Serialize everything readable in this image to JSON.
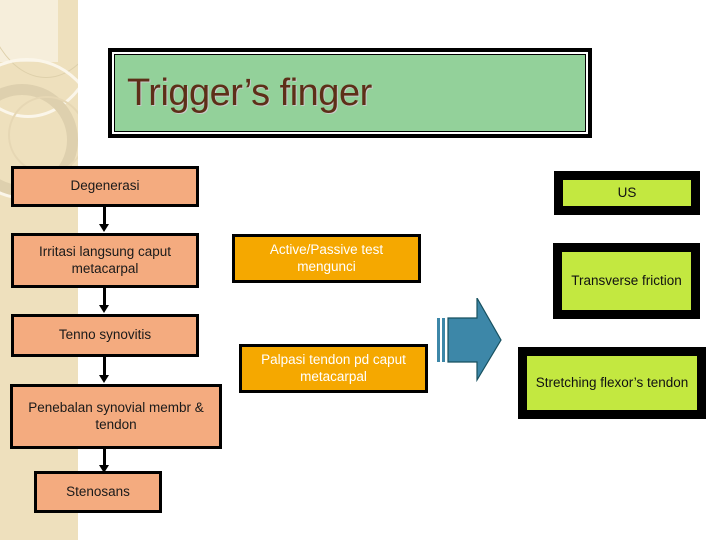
{
  "slide": {
    "title": "Trigger’s finger",
    "background_color": "#ffffff",
    "title_fill": "#93d19a",
    "title_text_color": "#5d2f18",
    "decor_band_color": "#eee0bd"
  },
  "palette": {
    "peach": "#f4ab7f",
    "amber": "#f5a800",
    "lime": "#c3e840",
    "teal_arrow": "#3d87a8",
    "border": "#000000"
  },
  "columns": {
    "pathology": {
      "fill": "#f4ab7f",
      "nodes": [
        {
          "label": "Degenerasi"
        },
        {
          "label": "Irritasi langsung caput metacarpal"
        },
        {
          "label": "Tenno synovitis"
        },
        {
          "label": "Penebalan synovial membr & tendon"
        },
        {
          "label": "Stenosans"
        }
      ]
    },
    "examination": {
      "fill": "#f5a800",
      "nodes": [
        {
          "label": "Active/Passive test mengunci"
        },
        {
          "label": "Palpasi tendon pd caput metacarpal"
        }
      ]
    },
    "intervention": {
      "fill": "#c3e840",
      "nodes": [
        {
          "label": "US"
        },
        {
          "label": "Transverse friction"
        },
        {
          "label": "Stretching flexor’s tendon"
        }
      ]
    }
  }
}
